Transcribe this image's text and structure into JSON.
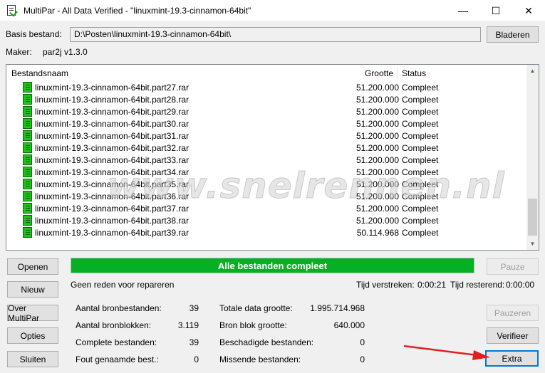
{
  "window": {
    "title": "MultiPar - All Data Verified - \"linuxmint-19.3-cinnamon-64bit\"",
    "minimize": "—",
    "maximize": "☐",
    "close": "✕"
  },
  "basis": {
    "label": "Basis bestand:",
    "value": "D:\\Posten\\linuxmint-19.3-cinnamon-64bit\\",
    "browse_button": "Bladeren"
  },
  "maker": {
    "label": "Maker:",
    "value": "par2j v1.3.0"
  },
  "file_list": {
    "columns": [
      "Bestandsnaam",
      "Grootte",
      "Status"
    ],
    "rows": [
      {
        "name": "linuxmint-19.3-cinnamon-64bit.part27.rar",
        "size": "51.200.000",
        "status": "Compleet"
      },
      {
        "name": "linuxmint-19.3-cinnamon-64bit.part28.rar",
        "size": "51.200.000",
        "status": "Compleet"
      },
      {
        "name": "linuxmint-19.3-cinnamon-64bit.part29.rar",
        "size": "51.200.000",
        "status": "Compleet"
      },
      {
        "name": "linuxmint-19.3-cinnamon-64bit.part30.rar",
        "size": "51.200.000",
        "status": "Compleet"
      },
      {
        "name": "linuxmint-19.3-cinnamon-64bit.part31.rar",
        "size": "51.200.000",
        "status": "Compleet"
      },
      {
        "name": "linuxmint-19.3-cinnamon-64bit.part32.rar",
        "size": "51.200.000",
        "status": "Compleet"
      },
      {
        "name": "linuxmint-19.3-cinnamon-64bit.part33.rar",
        "size": "51.200.000",
        "status": "Compleet"
      },
      {
        "name": "linuxmint-19.3-cinnamon-64bit.part34.rar",
        "size": "51.200.000",
        "status": "Compleet"
      },
      {
        "name": "linuxmint-19.3-cinnamon-64bit.part35.rar",
        "size": "51.200.000",
        "status": "Compleet"
      },
      {
        "name": "linuxmint-19.3-cinnamon-64bit.part36.rar",
        "size": "51.200.000",
        "status": "Compleet"
      },
      {
        "name": "linuxmint-19.3-cinnamon-64bit.part37.rar",
        "size": "51.200.000",
        "status": "Compleet"
      },
      {
        "name": "linuxmint-19.3-cinnamon-64bit.part38.rar",
        "size": "51.200.000",
        "status": "Compleet"
      },
      {
        "name": "linuxmint-19.3-cinnamon-64bit.part39.rar",
        "size": "50.114.968",
        "status": "Compleet"
      }
    ]
  },
  "buttons": {
    "open": "Openen",
    "new": "Nieuw",
    "about": "Over MultiPar",
    "options": "Opties",
    "close": "Sluiten",
    "pause": "Pauze",
    "pause_repair": "Pauzeren",
    "verify": "Verifieer",
    "extra": "Extra"
  },
  "progress": {
    "text": "Alle bestanden compleet",
    "fraction": 1.0,
    "color": "#06b025"
  },
  "status": {
    "message": "Geen reden voor repareren",
    "elapsed_label": "Tijd verstreken:",
    "elapsed_value": "0:00:21",
    "remaining_label": "Tijd resterend:",
    "remaining_value": "0:00:00"
  },
  "stats": {
    "source_files_label": "Aantal bronbestanden:",
    "source_files_value": "39",
    "source_blocks_label": "Aantal bronblokken:",
    "source_blocks_value": "3.119",
    "complete_files_label": "Complete bestanden:",
    "complete_files_value": "39",
    "misnamed_label": "Fout genaamde best.:",
    "misnamed_value": "0",
    "total_size_label": "Totale data grootte:",
    "total_size_value": "1.995.714.968",
    "block_size_label": "Bron blok grootte:",
    "block_size_value": "640.000",
    "damaged_label": "Beschadigde bestanden:",
    "damaged_value": "0",
    "missing_label": "Missende bestanden:",
    "missing_value": "0"
  },
  "watermark": "www.snelrennen.nl",
  "annotation_arrow_color": "#e02020"
}
